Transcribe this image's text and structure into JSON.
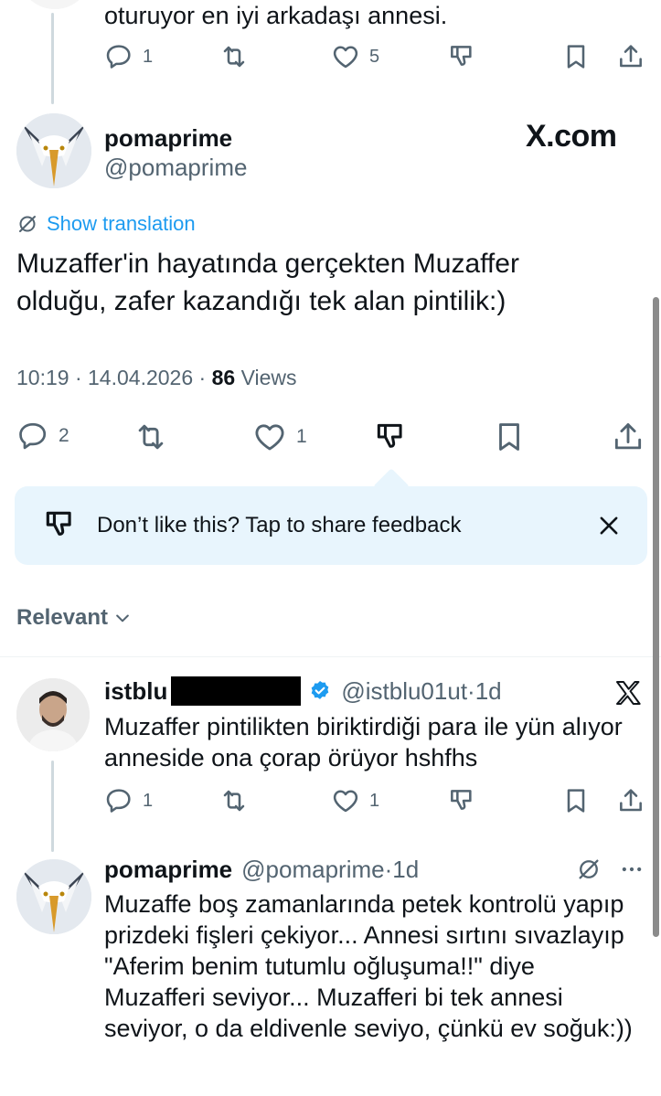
{
  "top_tweet": {
    "text_tail": "oturuyor en iyi arkadaşı annesi.",
    "replies": "1",
    "likes": "5"
  },
  "main_tweet": {
    "display_name": "pomaprime",
    "handle": "@pomaprime",
    "brand": "X.com",
    "show_translation": "Show translation",
    "text": "Muzaffer'in hayatında gerçekten Muzaffer olduğu, zafer kazandığı tek alan pintilik:)",
    "time": "10:19",
    "date": "14.04.2026",
    "views_count": "86",
    "views_label": " Views",
    "replies": "2",
    "likes": "1"
  },
  "feedback": {
    "text": "Don’t like this? Tap to share feedback"
  },
  "sort": {
    "label": "Relevant"
  },
  "reply1": {
    "display_name": "istblu",
    "handle": "@istblu01ut",
    "age": "1d",
    "text": "Muzaffer pintilikten biriktirdiği para ile yün alıyor anneside ona çorap örüyor hshfhs",
    "replies": "1",
    "likes": "1"
  },
  "reply2": {
    "display_name": "pomaprime",
    "handle": "@pomaprime",
    "age": "1d",
    "text": "Muzaffe boş zamanlarında petek kontrolü yapıp prizdeki fişleri çekiyor... Annesi sırtını sıvazlayıp \"Aferim benim tutumlu oğluşuma!!\" diye Muzafferi seviyor... Muzafferi bi tek annesi seviyor, o da eldivenle seviyo, çünkü ev soğuk:))"
  },
  "colors": {
    "accent": "#1d9bf0",
    "text": "#0f1419",
    "muted": "#536471",
    "feedback_bg": "#e8f5fd"
  }
}
